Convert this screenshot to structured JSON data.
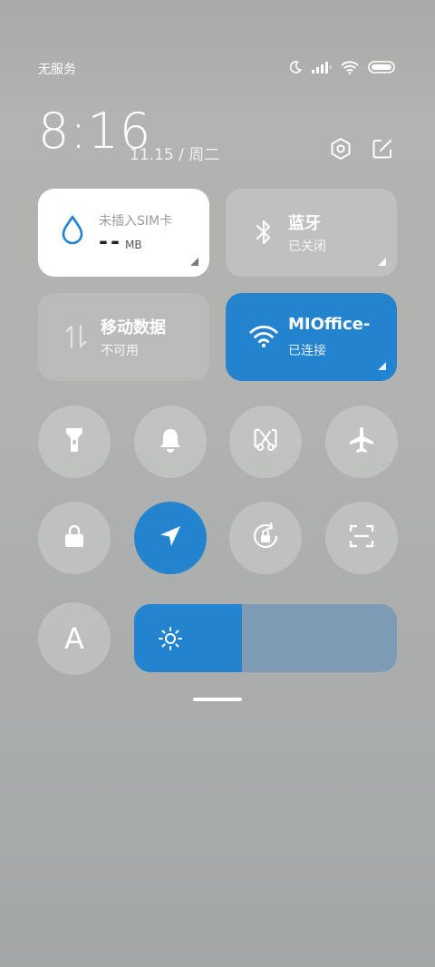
{
  "status_bar": {
    "carrier": "无服务",
    "icons": [
      "moon-icon",
      "signal-icon",
      "wifi-icon",
      "battery-icon"
    ]
  },
  "header": {
    "time": "8:16",
    "date": "11.15 / 周二",
    "icons": [
      "settings-icon",
      "edit-icon"
    ]
  },
  "cards": {
    "sim": {
      "label": "未插入SIM卡",
      "value": "--",
      "unit": "MB",
      "icon": "water-drop-icon"
    },
    "bluetooth": {
      "title": "蓝牙",
      "status": "已关闭",
      "icon": "bluetooth-icon"
    },
    "mobile_data": {
      "title": "移动数据",
      "status": "不可用",
      "icon": "data-arrows-icon"
    },
    "wifi": {
      "title": "MIOffice-",
      "status": "已连接",
      "icon": "wifi-icon"
    }
  },
  "toggles": [
    {
      "name": "flashlight",
      "icon": "flashlight-icon",
      "active": false
    },
    {
      "name": "bell",
      "icon": "bell-icon",
      "active": false
    },
    {
      "name": "screenshot",
      "icon": "screenshot-icon",
      "active": false
    },
    {
      "name": "airplane",
      "icon": "airplane-icon",
      "active": false
    },
    {
      "name": "lock",
      "icon": "lock-icon",
      "active": false
    },
    {
      "name": "location",
      "icon": "location-arrow-icon",
      "active": true
    },
    {
      "name": "rotation-lock",
      "icon": "rotation-lock-icon",
      "active": false
    },
    {
      "name": "scanner",
      "icon": "scan-icon",
      "active": false
    }
  ],
  "bottom": {
    "font_button": "A",
    "brightness_level": 0.41
  },
  "colors": {
    "accent": "#2383cf"
  }
}
